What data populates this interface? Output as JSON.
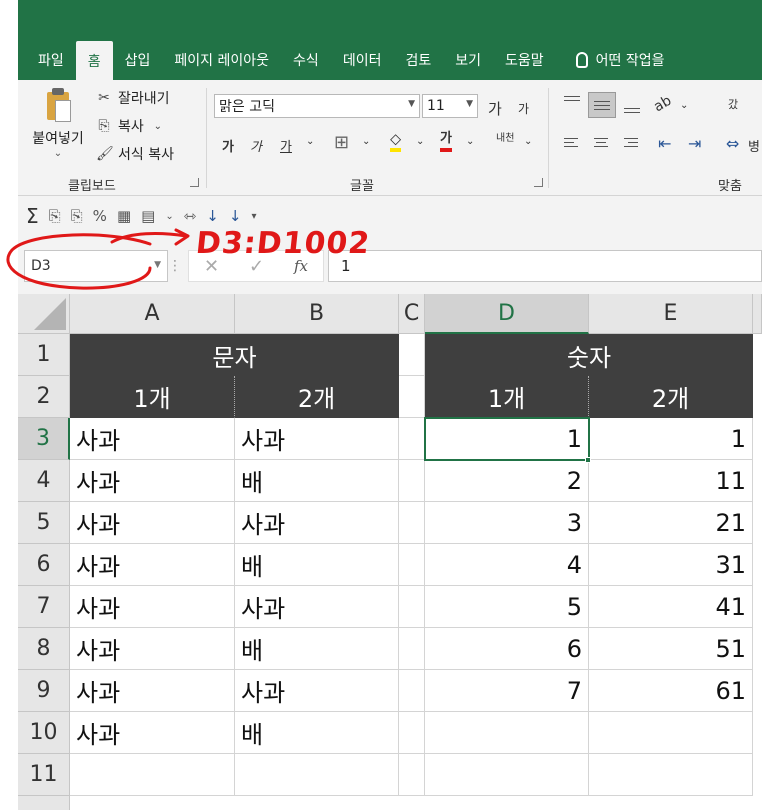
{
  "ribbon_tabs": [
    "파일",
    "홈",
    "삽입",
    "페이지 레이아웃",
    "수식",
    "데이터",
    "검토",
    "보기",
    "도움말"
  ],
  "active_tab": "홈",
  "help_search": "어떤 작업을",
  "clipboard": {
    "paste_label": "붙여넣기",
    "cut_label": "잘라내기",
    "copy_label": "복사",
    "format_painter_label": "서식 복사",
    "group_label": "클립보드"
  },
  "font": {
    "name": "맑은 고딕",
    "size": "11",
    "grow_glyph": "가",
    "shrink_glyph": "가",
    "bold_glyph": "가",
    "italic_glyph": "가",
    "underline_glyph": "가",
    "font_color_glyph": "가",
    "phonetic_glyph": "내천",
    "group_label": "글꼴"
  },
  "alignment": {
    "group_label": "맞춤",
    "wrap_glyph": "갔",
    "merge_glyph": "병"
  },
  "formula_bar": {
    "name_box": "D3",
    "formula": "1",
    "fx": "fx"
  },
  "annotation": "D3:D1002",
  "columns": [
    "A",
    "B",
    "C",
    "D",
    "E"
  ],
  "rows": [
    "1",
    "2",
    "3",
    "4",
    "5",
    "6",
    "7",
    "8",
    "9",
    "10",
    "11"
  ],
  "header": {
    "text_group": "문자",
    "number_group": "숫자",
    "one": "1개",
    "two": "2개"
  },
  "text_a": [
    "사과",
    "사과",
    "사과",
    "사과",
    "사과",
    "사과",
    "사과",
    "사과"
  ],
  "text_b": [
    "사과",
    "배",
    "사과",
    "배",
    "사과",
    "배",
    "사과",
    "배"
  ],
  "num_d": [
    "1",
    "2",
    "3",
    "4",
    "5",
    "6",
    "7"
  ],
  "num_e": [
    "1",
    "11",
    "21",
    "31",
    "41",
    "51",
    "61"
  ],
  "colors": {
    "excel_green": "#217346",
    "header_fill": "#3f3f3f",
    "annotation_red": "#e01818"
  }
}
